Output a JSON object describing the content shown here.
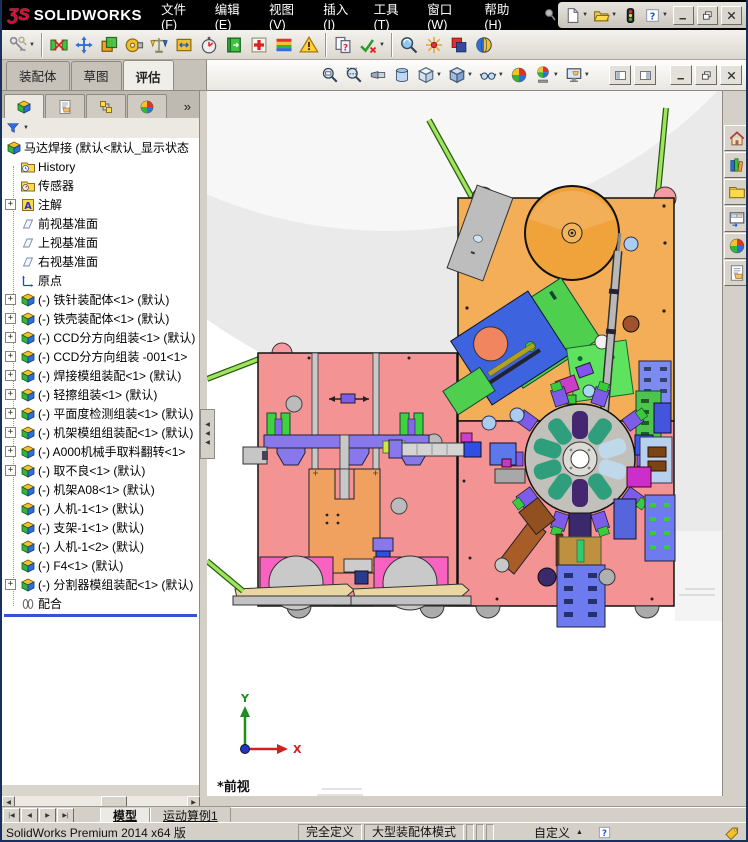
{
  "window": {
    "brand_mark": "ƷS",
    "brand": "SOLIDWORKS"
  },
  "titlebar": {
    "menus": [
      "文件(F)",
      "编辑(E)",
      "视图(V)",
      "插入(I)",
      "工具(T)",
      "窗口(W)",
      "帮助(H)"
    ]
  },
  "quickbar": {
    "items": [
      {
        "name": "new-document",
        "symbol": "newdoc",
        "dropdown": true
      },
      {
        "name": "open-document",
        "symbol": "openfolder",
        "dropdown": true
      },
      {
        "name": "traffic-light",
        "symbol": "traffic",
        "dropdown": false
      },
      {
        "name": "help",
        "symbol": "helpq",
        "dropdown": true
      }
    ],
    "window_buttons": [
      {
        "name": "window-minimize",
        "symbol": "winmin"
      },
      {
        "name": "window-restore",
        "symbol": "winrestore"
      },
      {
        "name": "window-close",
        "symbol": "winclose"
      }
    ]
  },
  "ribbon": {
    "items": [
      {
        "name": "keys",
        "symbol": "keys",
        "dropdown": true
      },
      {
        "sep": true
      },
      {
        "name": "interference-detection",
        "symbol": "interf"
      },
      {
        "name": "hole-alignment",
        "symbol": "holealign"
      },
      {
        "name": "assembly-xpert",
        "symbol": "xpertbox"
      },
      {
        "name": "measure",
        "symbol": "measure"
      },
      {
        "name": "mass-properties",
        "symbol": "scales"
      },
      {
        "name": "section-properties",
        "symbol": "sectprops"
      },
      {
        "name": "performance-evaluation",
        "symbol": "stopwatch"
      },
      {
        "name": "assembly-visualization",
        "symbol": "bookarrow"
      },
      {
        "name": "solidworks-rx",
        "symbol": "rx"
      },
      {
        "name": "curvature",
        "symbol": "rainbow"
      },
      {
        "name": "design-check-warning",
        "symbol": "warnbell"
      },
      {
        "sep": true
      },
      {
        "name": "compare-documents",
        "symbol": "comparedocs"
      },
      {
        "name": "check-active-document",
        "symbol": "checkdoc",
        "dropdown": true
      },
      {
        "sep": true
      },
      {
        "name": "magnified-view",
        "symbol": "maglens"
      },
      {
        "name": "symmetry-check",
        "symbol": "radial"
      },
      {
        "name": "motion-overlap",
        "symbol": "redsq"
      },
      {
        "name": "edrawings",
        "symbol": "sphereyb"
      }
    ]
  },
  "command_tabs": {
    "tabs": [
      "装配体",
      "草图",
      "评估"
    ],
    "active": 2
  },
  "headsup": {
    "tools": [
      {
        "name": "zoom-fit",
        "symbol": "magfit"
      },
      {
        "name": "zoom-area",
        "symbol": "magarea"
      },
      {
        "name": "previous-view",
        "symbol": "flashlight"
      },
      {
        "name": "section-view",
        "symbol": "sectioncyl"
      },
      {
        "name": "view-orientation",
        "symbol": "cubeoutline",
        "dropdown": true
      },
      {
        "name": "display-style",
        "symbol": "cubeshaded",
        "dropdown": true
      },
      {
        "name": "hide-show-items",
        "symbol": "glasses",
        "dropdown": true
      },
      {
        "name": "edit-appearance",
        "symbol": "sphere4"
      },
      {
        "name": "apply-scene",
        "symbol": "scenesphere",
        "dropdown": true
      },
      {
        "name": "view-settings",
        "symbol": "monitorhand",
        "dropdown": true
      }
    ],
    "pane_buttons": [
      {
        "name": "pane-left",
        "symbol": "paneL"
      },
      {
        "name": "pane-right",
        "symbol": "paneR"
      }
    ],
    "doc_window_buttons": [
      {
        "name": "doc-minimize",
        "symbol": "winmin"
      },
      {
        "name": "doc-restore",
        "symbol": "winrestore"
      },
      {
        "name": "doc-close",
        "symbol": "winclose"
      }
    ]
  },
  "featuremanager": {
    "tabs": [
      {
        "name": "feature-tree",
        "symbol": "asmcube"
      },
      {
        "name": "property-manager",
        "symbol": "pagehand"
      },
      {
        "name": "configuration-manager",
        "symbol": "configcubes"
      },
      {
        "name": "display-manager",
        "symbol": "sphere4"
      }
    ],
    "active": 0,
    "expand": "»",
    "filter_dropdown": "▼"
  },
  "tree": {
    "items": [
      {
        "label": "马达焊接 (默认<默认_显示状态",
        "icon": "assembly",
        "root": true
      },
      {
        "label": "History",
        "icon": "folder-history"
      },
      {
        "label": "传感器",
        "icon": "folder-sensor"
      },
      {
        "label": "注解",
        "icon": "annotations",
        "plus": true
      },
      {
        "label": "前视基准面",
        "icon": "plane"
      },
      {
        "label": "上视基准面",
        "icon": "plane"
      },
      {
        "label": "右视基准面",
        "icon": "plane"
      },
      {
        "label": "原点",
        "icon": "origin"
      },
      {
        "label": "(-) 铁针装配体<1> (默认)",
        "icon": "component",
        "plus": true
      },
      {
        "label": "(-) 铁壳装配体<1> (默认)",
        "icon": "component",
        "plus": true
      },
      {
        "label": "(-) CCD分方向组装<1> (默认)",
        "icon": "component",
        "plus": true
      },
      {
        "label": "(-) CCD分方向组装 -001<1>",
        "icon": "component",
        "plus": true
      },
      {
        "label": "(-) 焊接模组装配<1> (默认)",
        "icon": "component",
        "plus": true
      },
      {
        "label": "(-) 轻擦组装<1> (默认)",
        "icon": "component",
        "plus": true
      },
      {
        "label": "(-) 平面度检测组装<1> (默认)",
        "icon": "component",
        "plus": true
      },
      {
        "label": "(-) 机架模组组装配<1> (默认)",
        "icon": "component",
        "plus": true
      },
      {
        "label": "(-) A000机械手取料翻转<1>",
        "icon": "component",
        "plus": true
      },
      {
        "label": "(-) 取不良<1> (默认)",
        "icon": "component",
        "plus": true
      },
      {
        "label": "(-) 机架A08<1> (默认)",
        "icon": "component"
      },
      {
        "label": "(-) 人机-1<1> (默认)",
        "icon": "component"
      },
      {
        "label": "(-) 支架-1<1> (默认)",
        "icon": "component"
      },
      {
        "label": "(-) 人机-1<2> (默认)",
        "icon": "component"
      },
      {
        "label": "(-) F4<1> (默认)",
        "icon": "component"
      },
      {
        "label": "(-) 分割器模组装配<1> (默认)",
        "icon": "component",
        "plus": true
      },
      {
        "label": "配合",
        "icon": "mates"
      }
    ]
  },
  "taskpane": {
    "items": [
      {
        "name": "home",
        "symbol": "home"
      },
      {
        "name": "design-library",
        "symbol": "books"
      },
      {
        "name": "file-explorer",
        "symbol": "folderclosed"
      },
      {
        "name": "view-palette",
        "symbol": "viewpal"
      },
      {
        "name": "appearances",
        "symbol": "sphere4"
      },
      {
        "name": "custom-properties",
        "symbol": "pagehand"
      }
    ]
  },
  "viewport": {
    "view_label": "*前视",
    "axis_x": "X",
    "axis_y": "Y"
  },
  "doc_tabs": {
    "nav": [
      "|◀",
      "◀",
      "▶",
      "▶|"
    ],
    "tabs": [
      "模型",
      "运动算例1"
    ],
    "active": 0
  },
  "statusbar": {
    "product": "SolidWorks Premium 2014 x64 版",
    "definition": "完全定义",
    "mode": "大型装配体模式",
    "custom": "自定义",
    "custom_arrow": "▲",
    "help": "?"
  },
  "colors": {
    "accent": "#316AC5",
    "titlebar": "#000000",
    "plate_pink": "#F49394",
    "plate_orange": "#F3AE57",
    "plate_hotpink": "#FA62C2",
    "dial_gray": "#C2C0BA",
    "dial_teal": "#2F9E7D",
    "machine_green": "#4ED04E",
    "machine_blue": "#3D63DE",
    "machine_purple": "#8878EC",
    "rollback_blue": "#2F55D4",
    "rod_green": "#9FE45F"
  }
}
